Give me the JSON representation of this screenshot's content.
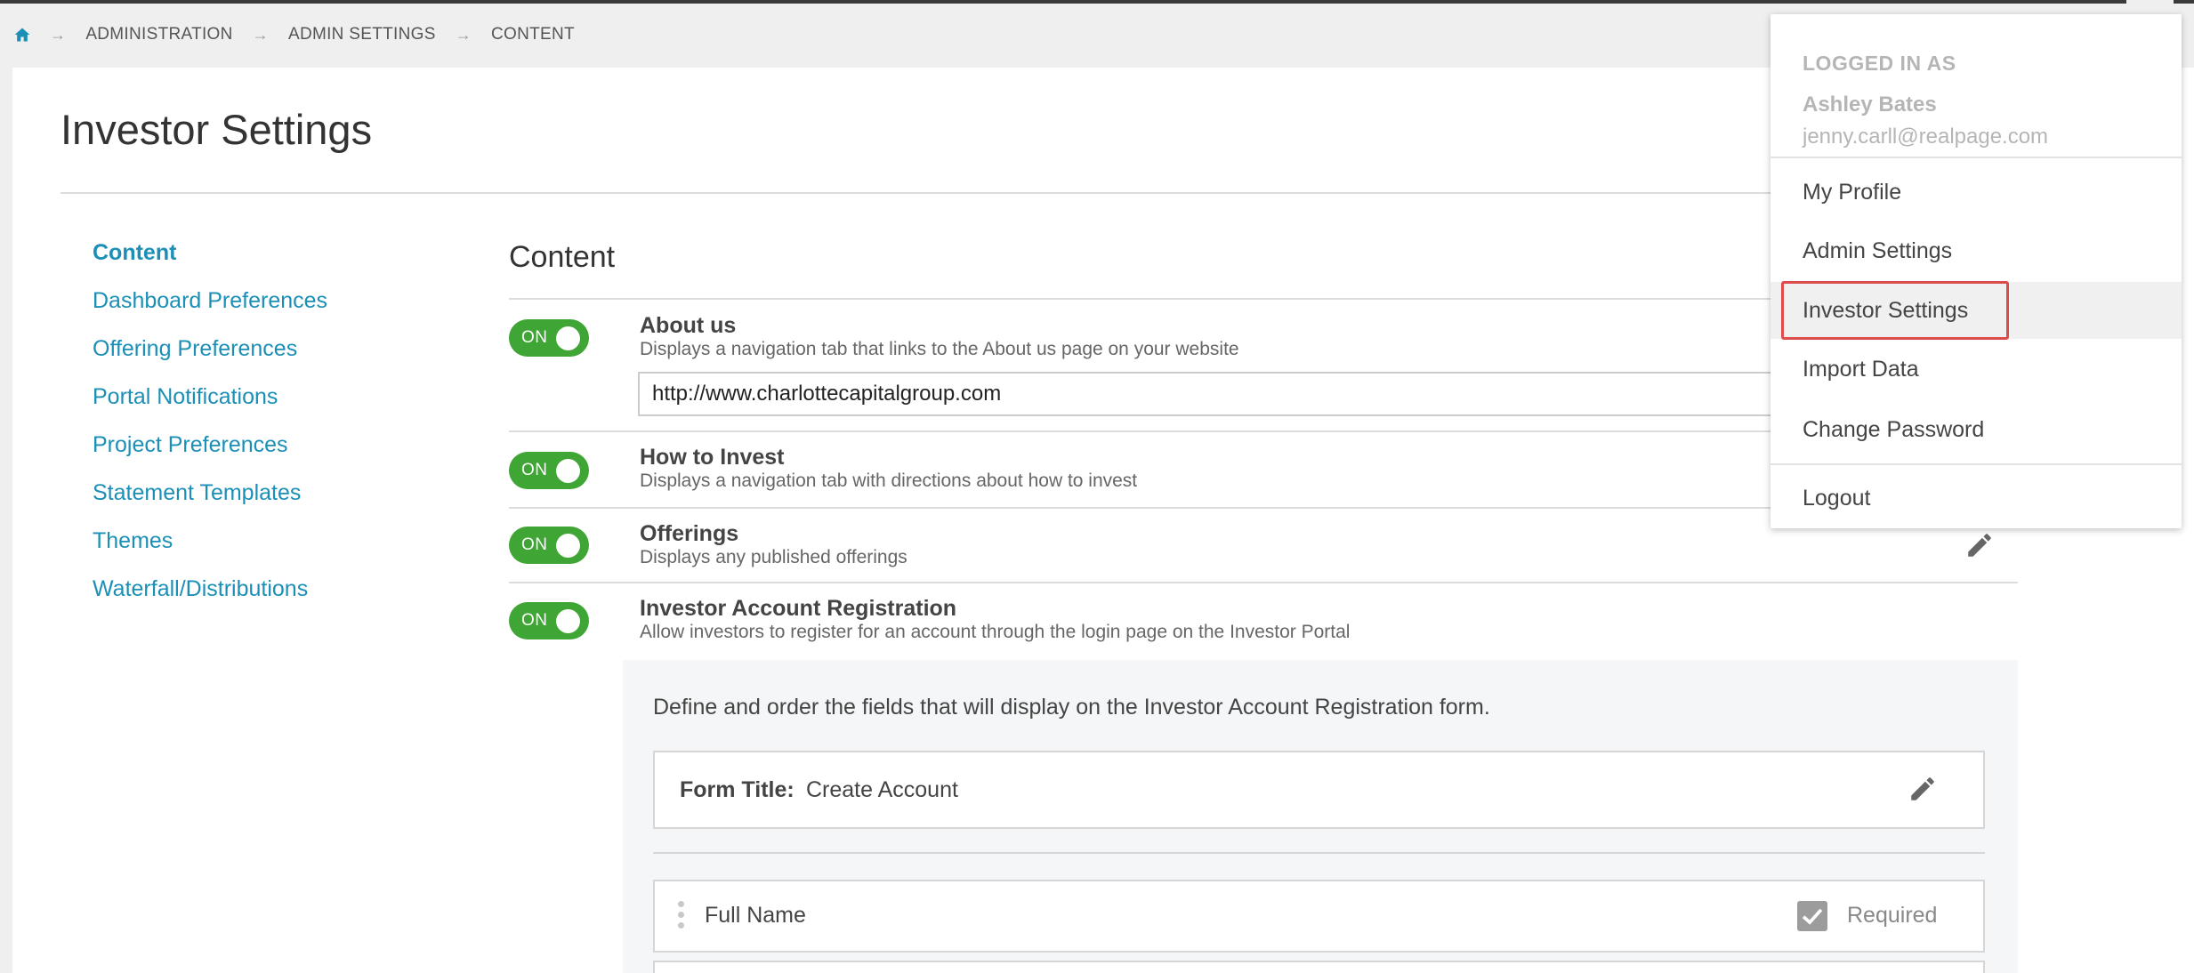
{
  "breadcrumb": {
    "items": [
      "ADMINISTRATION",
      "ADMIN SETTINGS",
      "CONTENT"
    ]
  },
  "page": {
    "title": "Investor Settings"
  },
  "sidenav": {
    "items": [
      {
        "label": "Content",
        "active": true
      },
      {
        "label": "Dashboard Preferences",
        "active": false
      },
      {
        "label": "Offering Preferences",
        "active": false
      },
      {
        "label": "Portal Notifications",
        "active": false
      },
      {
        "label": "Project Preferences",
        "active": false
      },
      {
        "label": "Statement Templates",
        "active": false
      },
      {
        "label": "Themes",
        "active": false
      },
      {
        "label": "Waterfall/Distributions",
        "active": false
      }
    ]
  },
  "content": {
    "section_title": "Content",
    "settings": [
      {
        "toggle_label": "ON",
        "title": "About us",
        "description": "Displays a navigation tab that links to the About us page on your website",
        "url_value": "http://www.charlottecapitalgroup.com"
      },
      {
        "toggle_label": "ON",
        "title": "How to Invest",
        "description": "Displays a navigation tab with directions about how to invest"
      },
      {
        "toggle_label": "ON",
        "title": "Offerings",
        "description": "Displays any published offerings"
      },
      {
        "toggle_label": "ON",
        "title": "Investor Account Registration",
        "description": "Allow investors to register for an account through the login page on the Investor Portal"
      }
    ],
    "registration": {
      "intro": "Define and order the fields that will display on the Investor Account Registration form.",
      "form_title_label": "Form Title:",
      "form_title_value": "Create Account",
      "fields": [
        {
          "name": "Full Name",
          "required_label": "Required",
          "required": true
        }
      ]
    }
  },
  "user_menu": {
    "header": "LOGGED IN AS",
    "user_name": "Ashley Bates",
    "user_email": "jenny.carll@realpage.com",
    "items": [
      "My Profile",
      "Admin Settings",
      "Investor Settings",
      "Import Data",
      "Change Password"
    ],
    "highlighted_item": "Investor Settings",
    "logout": "Logout"
  },
  "colors": {
    "accent": "#1c8fb7",
    "toggle_on": "#3fa535",
    "highlight_border": "#dd4b4b"
  },
  "icons": [
    "home-icon",
    "chevron-right-icon",
    "pencil-icon",
    "drag-handle-icon",
    "checkbox-icon"
  ]
}
